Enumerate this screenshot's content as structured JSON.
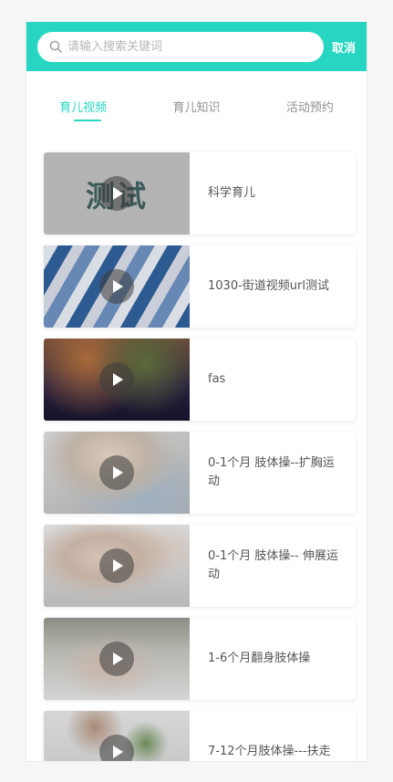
{
  "header": {
    "search_placeholder": "请输入搜索关键词",
    "search_value": "",
    "cancel_label": "取消"
  },
  "tabs": [
    {
      "label": "育儿视频",
      "active": true
    },
    {
      "label": "育儿知识",
      "active": false
    },
    {
      "label": "活动预约",
      "active": false
    }
  ],
  "videos": [
    {
      "title": "科学育儿",
      "thumb_text": "测试"
    },
    {
      "title": "1030-街道视频url测试"
    },
    {
      "title": "fas"
    },
    {
      "title": "0-1个月 肢体操--扩胸运动"
    },
    {
      "title": "0-1个月 肢体操-- 伸展运动"
    },
    {
      "title": "1-6个月翻身肢体操"
    },
    {
      "title": "7-12个月肢体操---扶走"
    }
  ],
  "colors": {
    "accent": "#26d6c2",
    "cancel_text": "#ffffff",
    "tab_inactive": "#8f8f8f"
  },
  "icons": {
    "search": "search-icon",
    "play": "play-icon"
  }
}
